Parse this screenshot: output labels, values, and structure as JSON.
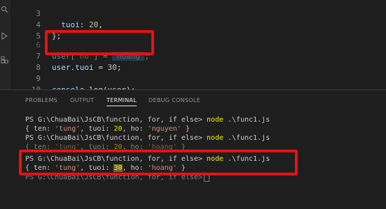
{
  "editor": {
    "lines": [
      {
        "num": "3",
        "indent": "  ",
        "key": "tuoi",
        "sep": ": ",
        "value": "20",
        "end": ","
      },
      {
        "num": "4",
        "text": "};"
      },
      {
        "num": "5",
        "text": ""
      },
      {
        "num": "6",
        "obj": "user",
        "bracket_open": "[\"",
        "prop": "ho",
        "bracket_close": "\"]",
        "assign": " = ",
        "value": "'hoang'",
        "end": ";"
      },
      {
        "num": "7",
        "obj": "user",
        "dot": ".",
        "prop": "tuoi",
        "assign": " = ",
        "value": "30",
        "end": ";"
      },
      {
        "num": "8",
        "text": ""
      },
      {
        "num": "9",
        "obj": "console",
        "dot": ".",
        "fn": "log",
        "args": "(user);"
      },
      {
        "num": "10",
        "text": ""
      }
    ]
  },
  "panel": {
    "tabs": [
      {
        "label": "PROBLEMS"
      },
      {
        "label": "OUTPUT"
      },
      {
        "label": "TERMINAL"
      },
      {
        "label": "DEBUG CONSOLE"
      }
    ],
    "active_tab": "TERMINAL"
  },
  "terminal": {
    "prompt": "PS G:\\ChuaBai\\JsCB\\function, for, if else>",
    "command": "node",
    "arg": " .\\func1.js",
    "out1": {
      "pre": "{ ten: ",
      "ten": "'tung'",
      "mid": ", tuoi: ",
      "tuoi": "20",
      "mid2": ", ho: ",
      "ho": "'nguyen'",
      "post": " }"
    },
    "out2": {
      "pre": "{ ten: ",
      "ten": "'tung'",
      "mid": ", tuoi: ",
      "tuoi": "20",
      "mid2": ", ho: ",
      "ho": "'hoang'",
      "post": " }"
    },
    "out3": {
      "pre": "{ ten: ",
      "ten": "'tung'",
      "mid": ", tuoi: ",
      "tuoi": "30",
      "mid2": ", ho: ",
      "ho": "'hoang'",
      "post": " }"
    }
  },
  "colors": {
    "annotation": "#e81212",
    "background": "#1e1e1e"
  }
}
